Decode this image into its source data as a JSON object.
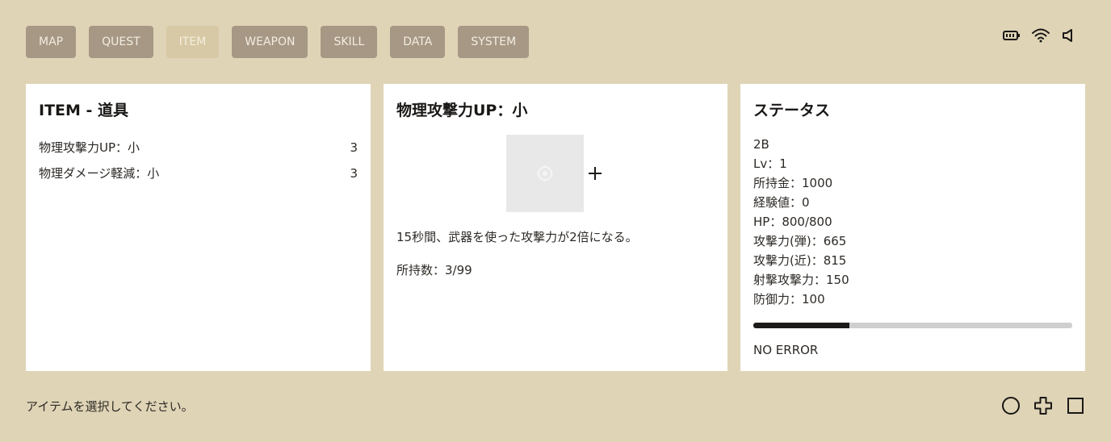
{
  "tabs": [
    {
      "label": "MAP"
    },
    {
      "label": "QUEST"
    },
    {
      "label": "ITEM",
      "active": true
    },
    {
      "label": "WEAPON"
    },
    {
      "label": "SKILL"
    },
    {
      "label": "DATA"
    },
    {
      "label": "SYSTEM"
    }
  ],
  "status_icons": [
    "battery-icon",
    "wifi-icon",
    "speaker-icon"
  ],
  "item_panel": {
    "title": "ITEM - 道具",
    "items": [
      {
        "name": "物理攻撃力UP：小",
        "count": "3"
      },
      {
        "name": "物理ダメージ軽減：小",
        "count": "3"
      }
    ]
  },
  "detail_panel": {
    "title": "物理攻撃力UP：小",
    "description": "15秒間、武器を使った攻撃力が2倍になる。",
    "count_line": "所持数：3/99"
  },
  "status_panel": {
    "title": "ステータス",
    "stats": [
      "2B",
      "Lv：1",
      "所持金：1000",
      "経験値：0",
      "HP：800/800",
      "攻撃力(弾)：665",
      "攻撃力(近)：815",
      "射撃攻撃力：150",
      "防御力：100"
    ],
    "progress": 0.3,
    "error_text": "NO ERROR"
  },
  "footer": {
    "message": "アイテムを選択してください。"
  },
  "controller_buttons": [
    "circle-button-icon",
    "dpad-icon",
    "square-button-icon"
  ],
  "colors": {
    "background": "#dfd4b6",
    "tab": "#a69885",
    "tab_active": "#d8c9a6",
    "panel": "#ffffff"
  }
}
